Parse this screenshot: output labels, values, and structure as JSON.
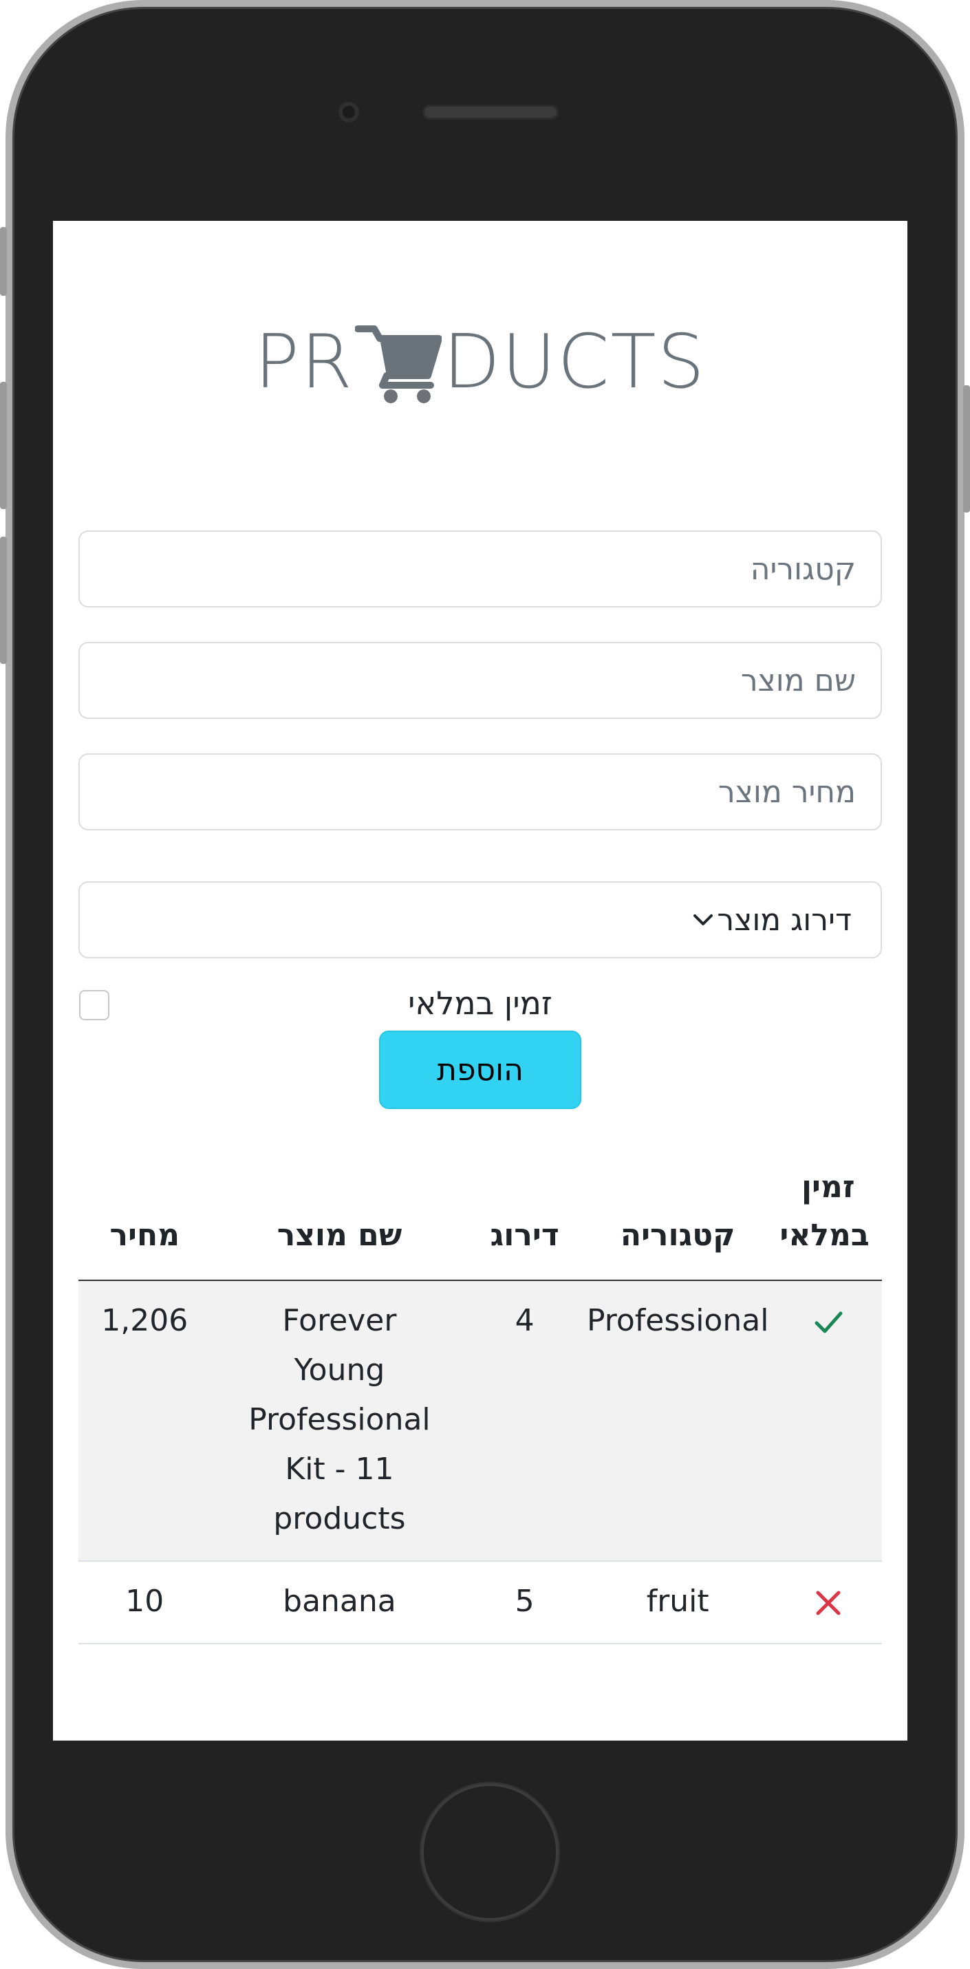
{
  "device": {
    "frame_color": "#222222"
  },
  "logo": {
    "text_before": "PR",
    "text_after": "DUCTS",
    "icon": "shopping-cart-icon",
    "color": "#6b737a"
  },
  "form": {
    "category_placeholder": "קטגוריה",
    "name_placeholder": "שם מוצר",
    "price_placeholder": "מחיר מוצר",
    "rating_select_label": "דירוג מוצר",
    "rating_select_icon": "chevron-down-icon",
    "in_stock_label": "זמין במלאי",
    "add_button_label": "הוספת",
    "add_button_color": "#31d2f2"
  },
  "table": {
    "headers": {
      "in_stock": "זמין במלאי",
      "category": "קטגוריה",
      "rating": "דירוג",
      "name": "שם מוצר",
      "price": "מחיר"
    },
    "rows": [
      {
        "in_stock_icon": "check-icon",
        "category": "Professional",
        "rating": "4",
        "name": "Forever Young Professional Kit - 11 products",
        "price": "1,206"
      },
      {
        "in_stock_icon": "x-icon",
        "category": "fruit",
        "rating": "5",
        "name": "banana",
        "price": "10"
      }
    ],
    "check_color": "#198754",
    "x_color": "#dc3545"
  }
}
